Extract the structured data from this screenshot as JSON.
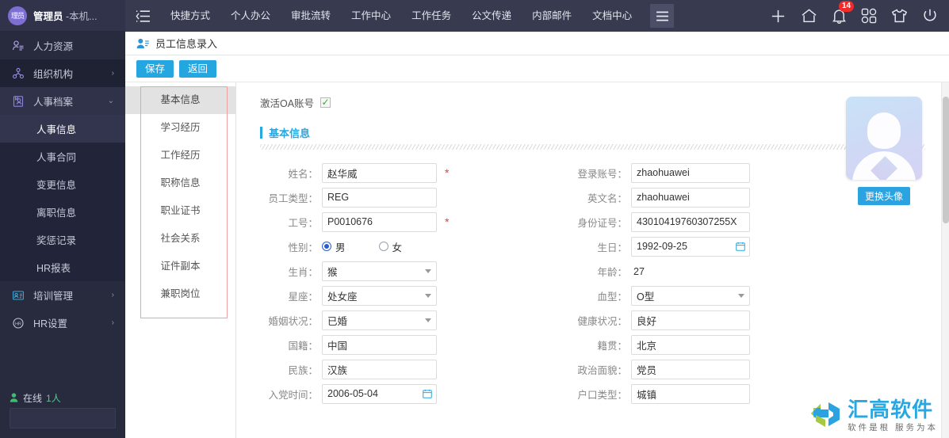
{
  "sidebar": {
    "user": {
      "avatar_text": "理员",
      "name": "管理员",
      "suffix": " -本机..."
    },
    "items": [
      {
        "label": "人力资源",
        "icon": "person-list-icon",
        "level": 0,
        "arrow": ""
      },
      {
        "label": "组织机构",
        "icon": "org-tree-icon",
        "level": 0,
        "arrow": "›"
      },
      {
        "label": "人事档案",
        "icon": "archive-person-icon",
        "level": 0,
        "arrow": "⌄"
      },
      {
        "label": "人事信息",
        "icon": "",
        "level": 1,
        "arrow": ""
      },
      {
        "label": "人事合同",
        "icon": "",
        "level": 1,
        "arrow": ""
      },
      {
        "label": "变更信息",
        "icon": "",
        "level": 1,
        "arrow": ""
      },
      {
        "label": "离职信息",
        "icon": "",
        "level": 1,
        "arrow": ""
      },
      {
        "label": "奖惩记录",
        "icon": "",
        "level": 1,
        "arrow": ""
      },
      {
        "label": "HR报表",
        "icon": "",
        "level": 1,
        "arrow": ""
      },
      {
        "label": "培训管理",
        "icon": "training-card-icon",
        "level": 0,
        "arrow": "›"
      },
      {
        "label": "HR设置",
        "icon": "hr-gear-icon",
        "level": 0,
        "arrow": "›"
      }
    ],
    "online": {
      "label": "在线",
      "count": "1人"
    },
    "search_placeholder": ""
  },
  "topbar": {
    "collapse_icon": "collapse-menu-icon",
    "nav": [
      "快捷方式",
      "个人办公",
      "审批流转",
      "工作中心",
      "工作任务",
      "公文传递",
      "内部邮件",
      "文档中心"
    ],
    "more_icon": "hamburger-icon",
    "right_icons": [
      {
        "name": "plus-icon",
        "badge": ""
      },
      {
        "name": "home-icon",
        "badge": ""
      },
      {
        "name": "bell-icon",
        "badge": "14"
      },
      {
        "name": "apps-grid-icon",
        "badge": ""
      },
      {
        "name": "shirt-theme-icon",
        "badge": ""
      },
      {
        "name": "power-icon",
        "badge": ""
      }
    ]
  },
  "breadcrumb": {
    "icon": "user-card-icon",
    "title": "员工信息录入"
  },
  "toolbar": {
    "save_label": "保存",
    "back_label": "返回"
  },
  "tabs": [
    {
      "label": "基本信息",
      "active": true
    },
    {
      "label": "学习经历",
      "active": false
    },
    {
      "label": "工作经历",
      "active": false
    },
    {
      "label": "职称信息",
      "active": false
    },
    {
      "label": "职业证书",
      "active": false
    },
    {
      "label": "社会关系",
      "active": false
    },
    {
      "label": "证件副本",
      "active": false
    },
    {
      "label": "兼职岗位",
      "active": false
    }
  ],
  "form": {
    "activate_label": "激活OA账号",
    "activate_checked": "✓",
    "section_title": "基本信息",
    "left": [
      {
        "label": "姓名：",
        "value": "赵华威",
        "type": "text",
        "required": true
      },
      {
        "label": "员工类型：",
        "value": "REG",
        "type": "text",
        "required": false
      },
      {
        "label": "工号：",
        "value": "P0010676",
        "type": "text",
        "required": true
      },
      {
        "label": "性别：",
        "type": "radio",
        "options": [
          "男",
          "女"
        ],
        "selected": "男"
      },
      {
        "label": "生肖：",
        "value": "猴",
        "type": "select"
      },
      {
        "label": "星座：",
        "value": "处女座",
        "type": "select"
      },
      {
        "label": "婚姻状况：",
        "value": "已婚",
        "type": "select"
      },
      {
        "label": "国籍：",
        "value": "中国",
        "type": "text"
      },
      {
        "label": "民族：",
        "value": "汉族",
        "type": "text"
      },
      {
        "label": "入党时间：",
        "value": "2006-05-04",
        "type": "date"
      }
    ],
    "right": [
      {
        "label": "登录账号：",
        "value": "zhaohuawei",
        "type": "text"
      },
      {
        "label": "英文名：",
        "value": "zhaohuawei",
        "type": "text"
      },
      {
        "label": "身份证号：",
        "value": "43010419760307255X",
        "type": "text"
      },
      {
        "label": "生日：",
        "value": "1992-09-25",
        "type": "date"
      },
      {
        "label": "年龄：",
        "value": "27",
        "type": "plain"
      },
      {
        "label": "血型：",
        "value": "O型",
        "type": "select"
      },
      {
        "label": "健康状况：",
        "value": "良好",
        "type": "text"
      },
      {
        "label": "籍贯：",
        "value": "北京",
        "type": "text"
      },
      {
        "label": "政治面貌：",
        "value": "党员",
        "type": "text"
      },
      {
        "label": "户口类型：",
        "value": "城镇",
        "type": "text"
      }
    ]
  },
  "avatar_panel": {
    "change_label": "更换头像",
    "image_name": "user-placeholder-avatar"
  },
  "watermark": {
    "main": "汇高软件",
    "sub": "软件是根 服务为本",
    "logo": "recycle-arrows-logo"
  },
  "colors": {
    "sidebar_bg": "#282b3e",
    "topbar_bg": "#383b50",
    "accent_blue": "#29a7e1",
    "badge_red": "#f02b2b",
    "online_green": "#57c98a",
    "tab_box_border": "#f0a0a0"
  }
}
